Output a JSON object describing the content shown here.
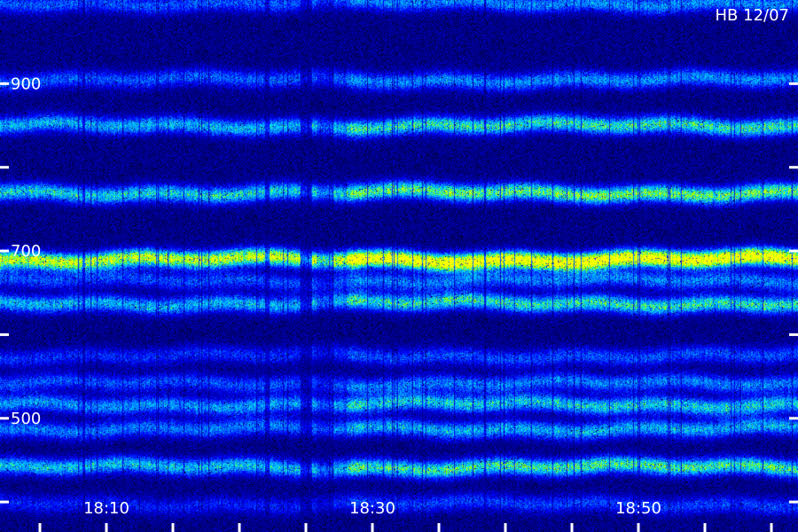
{
  "chart_data": {
    "type": "heatmap",
    "title": "HB 12/07",
    "xlabel": "",
    "ylabel": "",
    "x_ticks": [
      {
        "label": "18:10",
        "minute": 10
      },
      {
        "label": "18:30",
        "minute": 30
      },
      {
        "label": "18:50",
        "minute": 50
      }
    ],
    "xlim_minutes": [
      2,
      62
    ],
    "x_minor_step_minutes": 5,
    "y_ticks": [
      {
        "label": "900",
        "value": 900
      },
      {
        "label": "",
        "value": 800
      },
      {
        "label": "700",
        "value": 700
      },
      {
        "label": "",
        "value": 600
      },
      {
        "label": "500",
        "value": 500
      },
      {
        "label": "",
        "value": 400
      }
    ],
    "ylim": [
      380,
      1000
    ],
    "bands": [
      {
        "value": 997,
        "intensity": 0.3
      },
      {
        "value": 905,
        "intensity": 0.3
      },
      {
        "value": 850,
        "intensity": 0.45
      },
      {
        "value": 770,
        "intensity": 0.52
      },
      {
        "value": 690,
        "intensity": 0.85
      },
      {
        "value": 665,
        "intensity": 0.28
      },
      {
        "value": 638,
        "intensity": 0.45
      },
      {
        "value": 575,
        "intensity": 0.22
      },
      {
        "value": 542,
        "intensity": 0.28
      },
      {
        "value": 517,
        "intensity": 0.4
      },
      {
        "value": 488,
        "intensity": 0.35
      },
      {
        "value": 442,
        "intensity": 0.48
      },
      {
        "value": 398,
        "intensity": 0.2
      }
    ],
    "late_gain_after_minute": 28,
    "colormap": [
      "#000000",
      "#00008a",
      "#0000ff",
      "#0080ff",
      "#00e5ff",
      "#80ff00",
      "#ffff00"
    ]
  }
}
